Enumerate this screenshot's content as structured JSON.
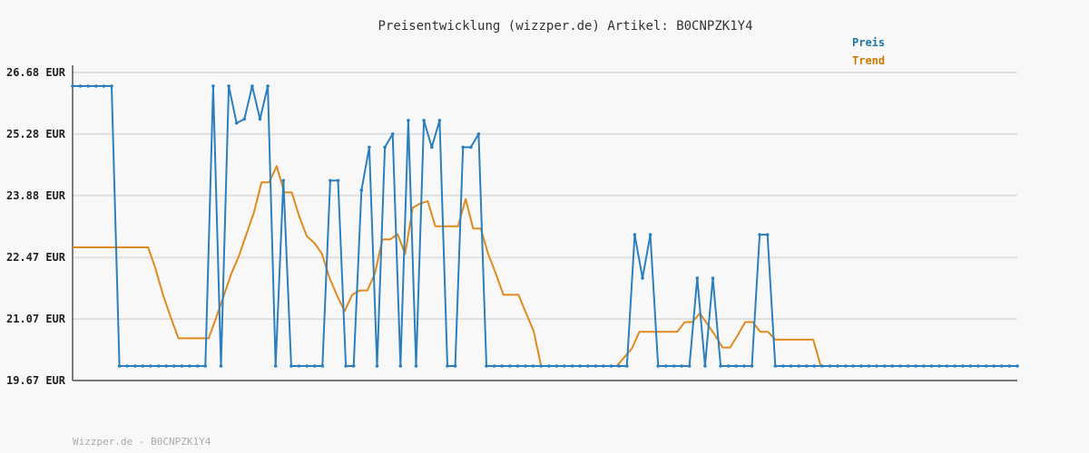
{
  "chart_data": {
    "type": "line",
    "title": "Preisentwicklung (wizzper.de) Artikel: B0CNPZK1Y4",
    "footer": "Wizzper.de - B0CNPZK1Y4",
    "y_unit": "EUR",
    "y_ticks": [
      19.67,
      21.07,
      22.47,
      23.88,
      25.28,
      26.68
    ],
    "y_tick_labels": [
      "19.67 EUR",
      "21.07 EUR",
      "22.47 EUR",
      "23.88 EUR",
      "25.28 EUR",
      "26.68 EUR"
    ],
    "ylim": [
      19.67,
      26.68
    ],
    "grid": "horizontal",
    "legend_position": "top-right",
    "colors": {
      "price": "#2b7fbf",
      "trend": "#e08a1e",
      "legend_price": "#1f77a8",
      "legend_trend": "#cc7a00",
      "grid": "#e0e0e0",
      "axis": "#555555"
    },
    "series": [
      {
        "name": "Preis",
        "key": "price",
        "values": [
          26.37,
          26.37,
          26.37,
          26.37,
          26.37,
          26.37,
          20.0,
          20.0,
          20.0,
          20.0,
          20.0,
          20.0,
          20.0,
          20.0,
          20.0,
          20.0,
          20.0,
          20.0,
          26.37,
          20.0,
          26.37,
          25.53,
          25.62,
          26.37,
          25.62,
          26.37,
          20.0,
          24.22,
          20.0,
          20.0,
          20.0,
          20.0,
          20.0,
          24.22,
          24.22,
          20.0,
          20.0,
          24.0,
          24.98,
          20.0,
          24.98,
          25.28,
          20.0,
          25.59,
          20.0,
          25.59,
          24.98,
          25.59,
          20.0,
          20.0,
          24.98,
          24.98,
          25.28,
          20.0,
          20.0,
          20.0,
          20.0,
          20.0,
          20.0,
          20.0,
          20.0,
          20.0,
          20.0,
          20.0,
          20.0,
          20.0,
          20.0,
          20.0,
          20.0,
          20.0,
          20.0,
          20.0,
          22.99,
          22.0,
          22.99,
          20.0,
          20.0,
          20.0,
          20.0,
          20.0,
          22.0,
          20.0,
          22.0,
          20.0,
          20.0,
          20.0,
          20.0,
          20.0,
          22.99,
          22.99,
          20.0,
          20.0,
          20.0,
          20.0,
          20.0,
          20.0,
          20.0,
          20.0,
          20.0,
          20.0,
          20.0,
          20.0,
          20.0,
          20.0,
          20.0,
          20.0,
          20.0,
          20.0,
          20.0,
          20.0,
          20.0,
          20.0,
          20.0,
          20.0,
          20.0,
          20.0,
          20.0,
          20.0,
          20.0,
          20.0,
          20.0,
          20.0
        ]
      },
      {
        "name": "Trend",
        "key": "trend",
        "values": [
          22.7,
          22.7,
          22.7,
          22.7,
          22.7,
          22.7,
          22.7,
          22.7,
          22.7,
          22.7,
          22.7,
          22.2,
          21.6,
          21.1,
          20.63,
          20.63,
          20.63,
          20.63,
          20.63,
          21.1,
          21.6,
          22.1,
          22.5,
          23.0,
          23.5,
          24.18,
          24.18,
          24.55,
          23.95,
          23.95,
          23.4,
          22.95,
          22.8,
          22.55,
          22.0,
          21.6,
          21.25,
          21.62,
          21.72,
          21.72,
          22.1,
          22.88,
          22.88,
          23.0,
          22.55,
          23.6,
          23.7,
          23.75,
          23.18,
          23.18,
          23.18,
          23.18,
          23.8,
          23.13,
          23.13,
          22.55,
          22.1,
          21.62,
          21.62,
          21.62,
          21.2,
          20.8,
          20.0,
          20.0,
          20.0,
          20.0,
          20.0,
          20.0,
          20.0,
          20.0,
          20.0,
          20.0,
          20.0,
          20.2,
          20.4,
          20.78,
          20.78,
          20.78,
          20.78,
          20.78,
          20.78,
          21.0,
          21.0,
          21.2,
          20.95,
          20.7,
          20.42,
          20.42,
          20.7,
          21.0,
          21.0,
          20.78,
          20.78,
          20.6,
          20.6,
          20.6,
          20.6,
          20.6,
          20.6,
          20.0,
          20.0,
          20.0,
          20.0,
          20.0,
          20.0,
          20.0,
          20.0,
          20.0,
          20.0,
          20.0,
          20.0,
          20.0,
          20.0,
          20.0,
          20.0,
          20.0,
          20.0,
          20.0,
          20.0,
          20.0,
          20.0,
          20.0,
          20.0,
          20.0,
          20.0,
          20.0
        ]
      }
    ]
  }
}
